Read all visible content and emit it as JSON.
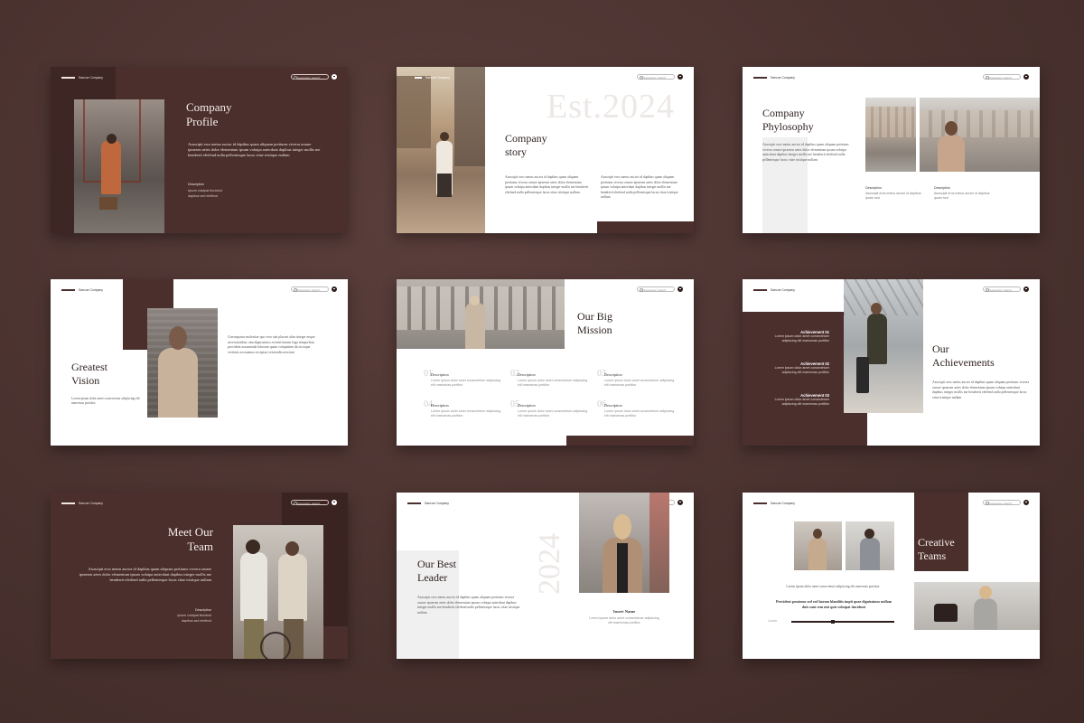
{
  "brand": "Saecue Company",
  "search_placeholder": "Suggestion Search",
  "colors": {
    "background": "#4a322f",
    "slide_dark": "#4b2f2c",
    "slide_light": "#ffffff",
    "accent_light": "#eeeeee"
  },
  "lorem4": "Asuscipit eros metus auctor id dapibus quam aliquam pretiums viverra ornare ipraesen aetes dolor elementum ipsum volutpa antecdunt dapibus integer mollis me hendrerit eleifend nulla pellentesque lacus vitae tristique nullam",
  "lorem_small": "Lorem ipsum dolor amet consectetuer adipiscing elit maecenas porttitor",
  "slides": [
    {
      "title_line1": "Company",
      "title_line2": "Profile",
      "desc_label": "Description",
      "desc_text_line1": "Ipsum volutpat tincidunt",
      "desc_text_line2": "dapibus sed eleifend"
    },
    {
      "watermark": "Est.2024",
      "title_line1": "Company",
      "title_line2": "story"
    },
    {
      "title_line1": "Company",
      "title_line2": "Phylosophy",
      "desc_label": "Description",
      "desc_text": "Asuscipit eros metus auctor id dapibus quam sed"
    },
    {
      "title_line1": "Greatest",
      "title_line2": "Vision",
      "body_text": "Consequatur molestiae quo vero sint placeat alias integer neque necessitatibus cum dignissimos eveniet harum fuga temporibus provident assumenda laborum quam voluptatem dicta eaque veritatis accusamus excepturi reiciendis nesciunt"
    },
    {
      "title_line1": "Our Big",
      "title_line2": "Mission",
      "items": [
        {
          "num": "01",
          "label": "Description"
        },
        {
          "num": "02",
          "label": "Description"
        },
        {
          "num": "03",
          "label": "Description"
        },
        {
          "num": "04",
          "label": "Description"
        },
        {
          "num": "05",
          "label": "Description"
        },
        {
          "num": "06",
          "label": "Description"
        }
      ]
    },
    {
      "title_line1": "Our",
      "title_line2": "Achievements",
      "achievements": [
        "Achievement 01",
        "Achievement 02",
        "Achievement 03"
      ]
    },
    {
      "title_line1": "Meet Our",
      "title_line2": "Team",
      "desc_label": "Description",
      "desc_text_line1": "ipsum volutpat tincidunt",
      "desc_text_line2": "dapibus sed eleifend"
    },
    {
      "watermark": "2024",
      "title_line1": "Our Best",
      "title_line2": "Leader",
      "name": "Insert Name"
    },
    {
      "title_line1": "Creative",
      "title_line2": "Teams",
      "bold_line": "Provident possimus sed sed harum blanditis impit quae dignissimos nullam duis sunt rem nisi quis volutpat tincidunt",
      "progress_label": "Lorem",
      "progress": 0.4
    }
  ]
}
